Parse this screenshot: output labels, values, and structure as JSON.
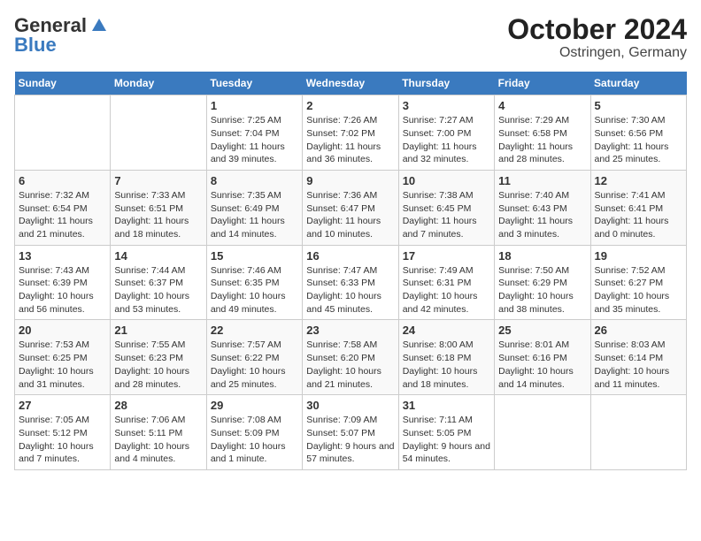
{
  "header": {
    "logo_general": "General",
    "logo_blue": "Blue",
    "month": "October 2024",
    "location": "Ostringen, Germany"
  },
  "weekdays": [
    "Sunday",
    "Monday",
    "Tuesday",
    "Wednesday",
    "Thursday",
    "Friday",
    "Saturday"
  ],
  "weeks": [
    [
      {
        "day": "",
        "info": ""
      },
      {
        "day": "",
        "info": ""
      },
      {
        "day": "1",
        "info": "Sunrise: 7:25 AM\nSunset: 7:04 PM\nDaylight: 11 hours and 39 minutes."
      },
      {
        "day": "2",
        "info": "Sunrise: 7:26 AM\nSunset: 7:02 PM\nDaylight: 11 hours and 36 minutes."
      },
      {
        "day": "3",
        "info": "Sunrise: 7:27 AM\nSunset: 7:00 PM\nDaylight: 11 hours and 32 minutes."
      },
      {
        "day": "4",
        "info": "Sunrise: 7:29 AM\nSunset: 6:58 PM\nDaylight: 11 hours and 28 minutes."
      },
      {
        "day": "5",
        "info": "Sunrise: 7:30 AM\nSunset: 6:56 PM\nDaylight: 11 hours and 25 minutes."
      }
    ],
    [
      {
        "day": "6",
        "info": "Sunrise: 7:32 AM\nSunset: 6:54 PM\nDaylight: 11 hours and 21 minutes."
      },
      {
        "day": "7",
        "info": "Sunrise: 7:33 AM\nSunset: 6:51 PM\nDaylight: 11 hours and 18 minutes."
      },
      {
        "day": "8",
        "info": "Sunrise: 7:35 AM\nSunset: 6:49 PM\nDaylight: 11 hours and 14 minutes."
      },
      {
        "day": "9",
        "info": "Sunrise: 7:36 AM\nSunset: 6:47 PM\nDaylight: 11 hours and 10 minutes."
      },
      {
        "day": "10",
        "info": "Sunrise: 7:38 AM\nSunset: 6:45 PM\nDaylight: 11 hours and 7 minutes."
      },
      {
        "day": "11",
        "info": "Sunrise: 7:40 AM\nSunset: 6:43 PM\nDaylight: 11 hours and 3 minutes."
      },
      {
        "day": "12",
        "info": "Sunrise: 7:41 AM\nSunset: 6:41 PM\nDaylight: 11 hours and 0 minutes."
      }
    ],
    [
      {
        "day": "13",
        "info": "Sunrise: 7:43 AM\nSunset: 6:39 PM\nDaylight: 10 hours and 56 minutes."
      },
      {
        "day": "14",
        "info": "Sunrise: 7:44 AM\nSunset: 6:37 PM\nDaylight: 10 hours and 53 minutes."
      },
      {
        "day": "15",
        "info": "Sunrise: 7:46 AM\nSunset: 6:35 PM\nDaylight: 10 hours and 49 minutes."
      },
      {
        "day": "16",
        "info": "Sunrise: 7:47 AM\nSunset: 6:33 PM\nDaylight: 10 hours and 45 minutes."
      },
      {
        "day": "17",
        "info": "Sunrise: 7:49 AM\nSunset: 6:31 PM\nDaylight: 10 hours and 42 minutes."
      },
      {
        "day": "18",
        "info": "Sunrise: 7:50 AM\nSunset: 6:29 PM\nDaylight: 10 hours and 38 minutes."
      },
      {
        "day": "19",
        "info": "Sunrise: 7:52 AM\nSunset: 6:27 PM\nDaylight: 10 hours and 35 minutes."
      }
    ],
    [
      {
        "day": "20",
        "info": "Sunrise: 7:53 AM\nSunset: 6:25 PM\nDaylight: 10 hours and 31 minutes."
      },
      {
        "day": "21",
        "info": "Sunrise: 7:55 AM\nSunset: 6:23 PM\nDaylight: 10 hours and 28 minutes."
      },
      {
        "day": "22",
        "info": "Sunrise: 7:57 AM\nSunset: 6:22 PM\nDaylight: 10 hours and 25 minutes."
      },
      {
        "day": "23",
        "info": "Sunrise: 7:58 AM\nSunset: 6:20 PM\nDaylight: 10 hours and 21 minutes."
      },
      {
        "day": "24",
        "info": "Sunrise: 8:00 AM\nSunset: 6:18 PM\nDaylight: 10 hours and 18 minutes."
      },
      {
        "day": "25",
        "info": "Sunrise: 8:01 AM\nSunset: 6:16 PM\nDaylight: 10 hours and 14 minutes."
      },
      {
        "day": "26",
        "info": "Sunrise: 8:03 AM\nSunset: 6:14 PM\nDaylight: 10 hours and 11 minutes."
      }
    ],
    [
      {
        "day": "27",
        "info": "Sunrise: 7:05 AM\nSunset: 5:12 PM\nDaylight: 10 hours and 7 minutes."
      },
      {
        "day": "28",
        "info": "Sunrise: 7:06 AM\nSunset: 5:11 PM\nDaylight: 10 hours and 4 minutes."
      },
      {
        "day": "29",
        "info": "Sunrise: 7:08 AM\nSunset: 5:09 PM\nDaylight: 10 hours and 1 minute."
      },
      {
        "day": "30",
        "info": "Sunrise: 7:09 AM\nSunset: 5:07 PM\nDaylight: 9 hours and 57 minutes."
      },
      {
        "day": "31",
        "info": "Sunrise: 7:11 AM\nSunset: 5:05 PM\nDaylight: 9 hours and 54 minutes."
      },
      {
        "day": "",
        "info": ""
      },
      {
        "day": "",
        "info": ""
      }
    ]
  ]
}
